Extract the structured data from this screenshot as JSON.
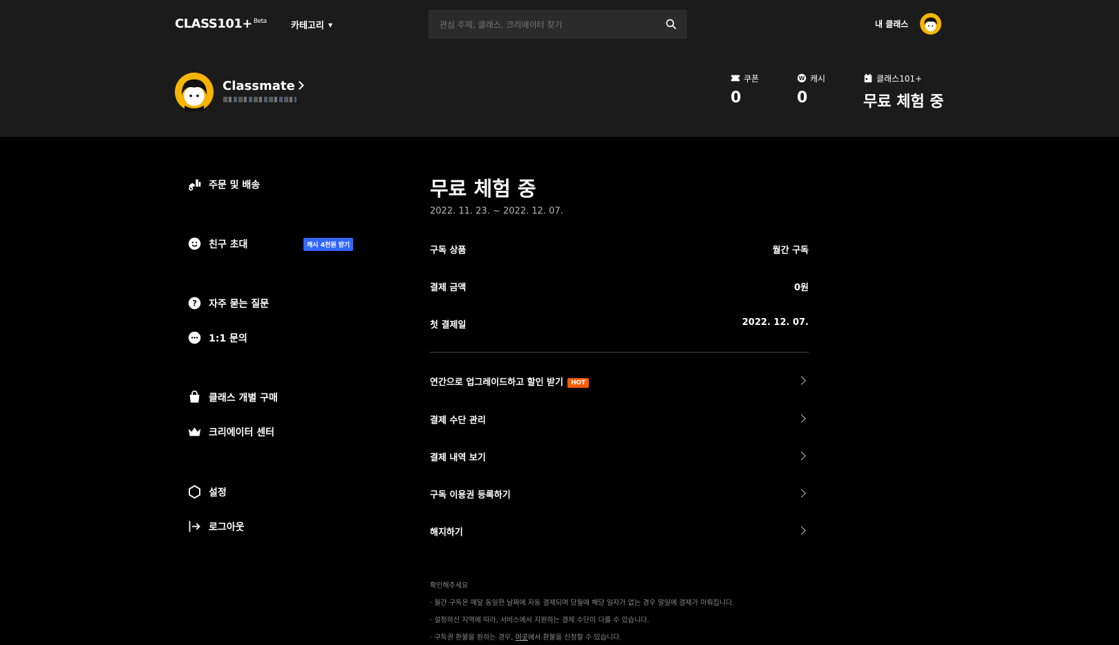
{
  "header": {
    "logo": "CLASS101+",
    "logo_sup": "Beta",
    "category": "카테고리",
    "search_placeholder": "관심 주제, 클래스, 크리에이터 찾기",
    "my_class": "내 클래스"
  },
  "profile": {
    "name": "Classmate",
    "stats": [
      {
        "label": "쿠폰",
        "value": "0"
      },
      {
        "label": "캐시",
        "value": "0"
      },
      {
        "label": "클래스101+",
        "value": "무료 체험 중"
      }
    ]
  },
  "sidebar": {
    "items": [
      {
        "label": "주문 및 배송"
      },
      {
        "label": "친구 초대",
        "badge": "캐시 4천원 받기"
      },
      {
        "label": "자주 묻는 질문"
      },
      {
        "label": "1:1 문의"
      },
      {
        "label": "클래스 개별 구매"
      },
      {
        "label": "크리에이터 센터"
      },
      {
        "label": "설정"
      },
      {
        "label": "로그아웃"
      }
    ]
  },
  "main": {
    "title": "무료 체험 중",
    "period": "2022. 11. 23. ~ 2022. 12. 07.",
    "rows": [
      {
        "key": "구독 상품",
        "value": "월간 구독"
      },
      {
        "key": "결제 금액",
        "value": "0원"
      },
      {
        "key": "첫 결제일",
        "value": "2022. 12. 07."
      }
    ],
    "menus": [
      {
        "label": "연간으로 업그레이드하고 할인 받기",
        "badge": "HOT"
      },
      {
        "label": "결제 수단 관리"
      },
      {
        "label": "결제 내역 보기"
      },
      {
        "label": "구독 이용권 등록하기"
      },
      {
        "label": "해지하기"
      }
    ],
    "notice_title": "확인해주세요",
    "notices": [
      "· 월간 구독은 매달 동일한 날짜에 자동 결제되며 당월에 해당 일자가 없는 경우 말일에 결제가 이뤄집니다.",
      "· 설정하신 지역에 따라, 서비스에서 지원하는 결제 수단이 다를 수 있습니다."
    ],
    "notice3_prefix": "· 구독권 환불을 원하는 경우, ",
    "notice3_link": "이곳",
    "notice3_suffix": "에서 환불을 신청할 수 있습니다."
  },
  "colors": {
    "accent_blue": "#3366ff",
    "hot_orange": "#ff5a00",
    "avatar_yellow": "#f5b400"
  }
}
